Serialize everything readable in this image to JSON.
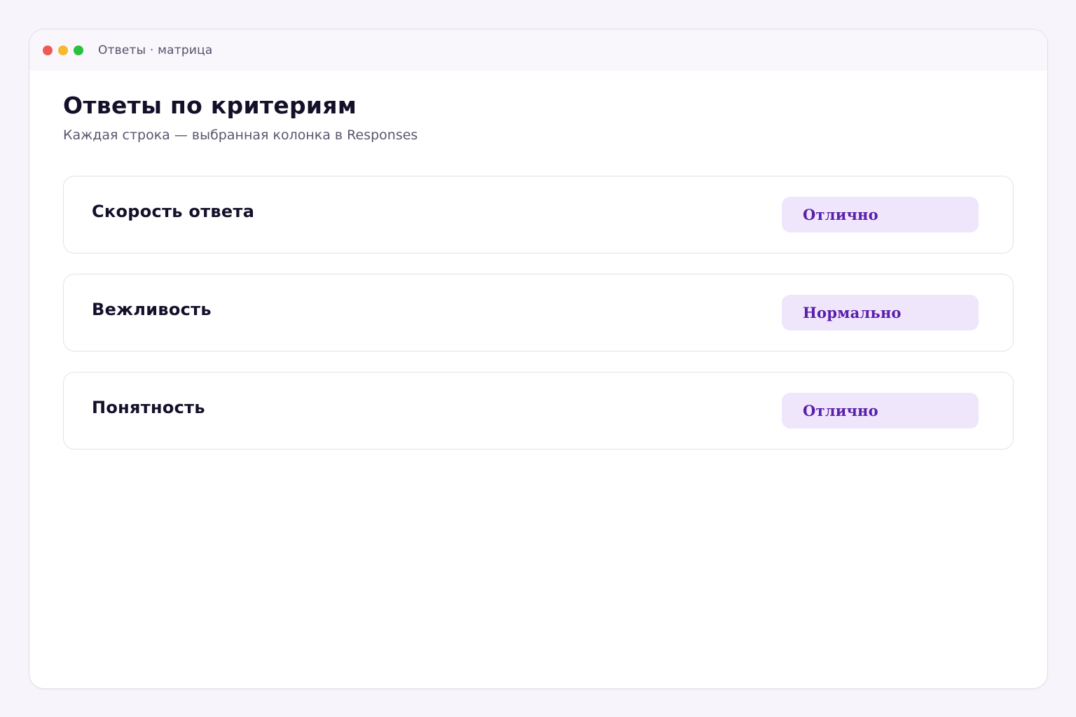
{
  "window": {
    "title": "Ответы · матрица"
  },
  "page": {
    "title": "Ответы по критериям",
    "subtitle": "Каждая строка — выбранная колонка в Responses"
  },
  "rows": [
    {
      "label": "Скорость ответа",
      "answer": "Отлично"
    },
    {
      "label": "Вежливость",
      "answer": "Нормально"
    },
    {
      "label": "Понятность",
      "answer": "Отлично"
    }
  ],
  "colors": {
    "accent": "#5a1faa",
    "pill_background": "#efe6fc",
    "close": "#ed5a55",
    "minimize": "#f5b82e",
    "maximize": "#29c13f"
  }
}
